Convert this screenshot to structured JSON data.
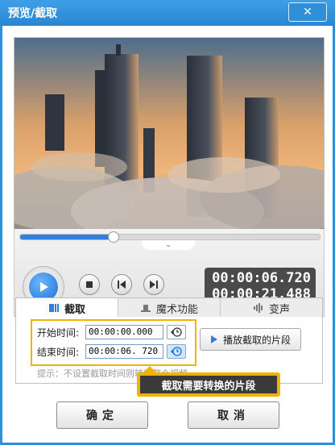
{
  "window": {
    "title": "预览/截取",
    "close_glyph": "✕"
  },
  "player": {
    "current_time": "00:00:06.720",
    "total_time": "00:00:21.488",
    "seek_progress": 0.31,
    "volume_level": 1.0
  },
  "tabs": [
    {
      "label": "截取",
      "icon": "clip-icon"
    },
    {
      "label": "魔术功能",
      "icon": "magic-hat-icon"
    },
    {
      "label": "变声",
      "icon": "voice-wave-icon"
    }
  ],
  "clip": {
    "start_label": "开始时间:",
    "start_value": "00:00:00.000",
    "end_label": "结束时间:",
    "end_value": "00:00:06. 720",
    "play_clip_label": "播放截取的片段",
    "hint": "提示：不设置截取时间则转换整个视频"
  },
  "tooltip": {
    "text": "截取需要转换的片段"
  },
  "buttons": {
    "ok": "确定",
    "cancel": "取消"
  },
  "colors": {
    "accent": "#2f80dd",
    "titlebar": "#2f8fd8",
    "highlight": "#f0b400"
  }
}
